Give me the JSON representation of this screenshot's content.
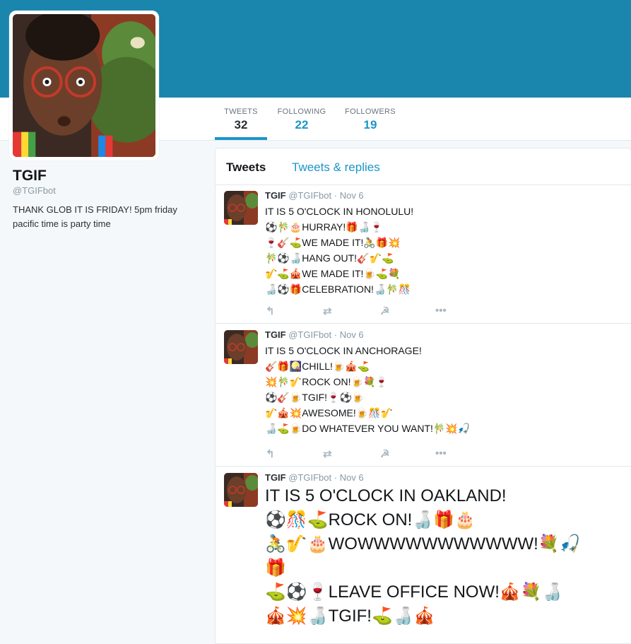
{
  "profile": {
    "name": "TGIF",
    "handle": "@TGIFbot",
    "bio": "THANK GLOB IT IS FRIDAY! 5pm friday pacific time is party time"
  },
  "stats": [
    {
      "label": "TWEETS",
      "value": "32"
    },
    {
      "label": "FOLLOWING",
      "value": "22"
    },
    {
      "label": "FOLLOWERS",
      "value": "19"
    }
  ],
  "timeline": {
    "tabs": [
      "Tweets",
      "Tweets & replies"
    ]
  },
  "tweets": [
    {
      "name": "TGIF",
      "handle": "@TGIFbot",
      "sep": "·",
      "date": "Nov 6",
      "text": "IT IS 5 O'CLOCK IN HONOLULU!\n⚽🎋🎂HURRAY!🎁🍶🍷\n🍷🎸⛳WE MADE IT!🚴🎁💥\n🎋⚽🍶HANG OUT!🎸🎷⛳\n🎷⛳🎪WE MADE IT!🍺⛳💐\n🍶⚽🎁CELEBRATION!🍶🎋🎊"
    },
    {
      "name": "TGIF",
      "handle": "@TGIFbot",
      "sep": "·",
      "date": "Nov 6",
      "text": "IT IS 5 O'CLOCK IN ANCHORAGE!\n🎸🎁🎑CHILL!🍺🎪⛳\n💥🎋🎷ROCK ON!🍺💐🍷\n⚽🎸🍺TGIF!🍷⚽🍺\n🎷🎪💥AWESOME!🍺🎊🎷\n🍶⛳🍺DO WHATEVER YOU WANT!🎋💥🎣"
    },
    {
      "name": "TGIF",
      "handle": "@TGIFbot",
      "sep": "·",
      "date": "Nov 6",
      "text": "IT IS 5 O'CLOCK IN OAKLAND!\n⚽🎊⛳ROCK ON!🍶🎁🎂\n🚴🎷🎂WOWWWWWWWWWWW!💐🎣\n🎁\n⛳⚽🍷LEAVE OFFICE NOW!🎪💐🍶\n🎪💥🍶TGIF!⛳🍶🎪"
    }
  ],
  "tweet_actions": {
    "reply": "↰",
    "retweet": "⇄",
    "favorite": "☭",
    "more": "•••"
  },
  "colors": {
    "banner": "#1a85ad",
    "accent": "#1b95c9"
  }
}
